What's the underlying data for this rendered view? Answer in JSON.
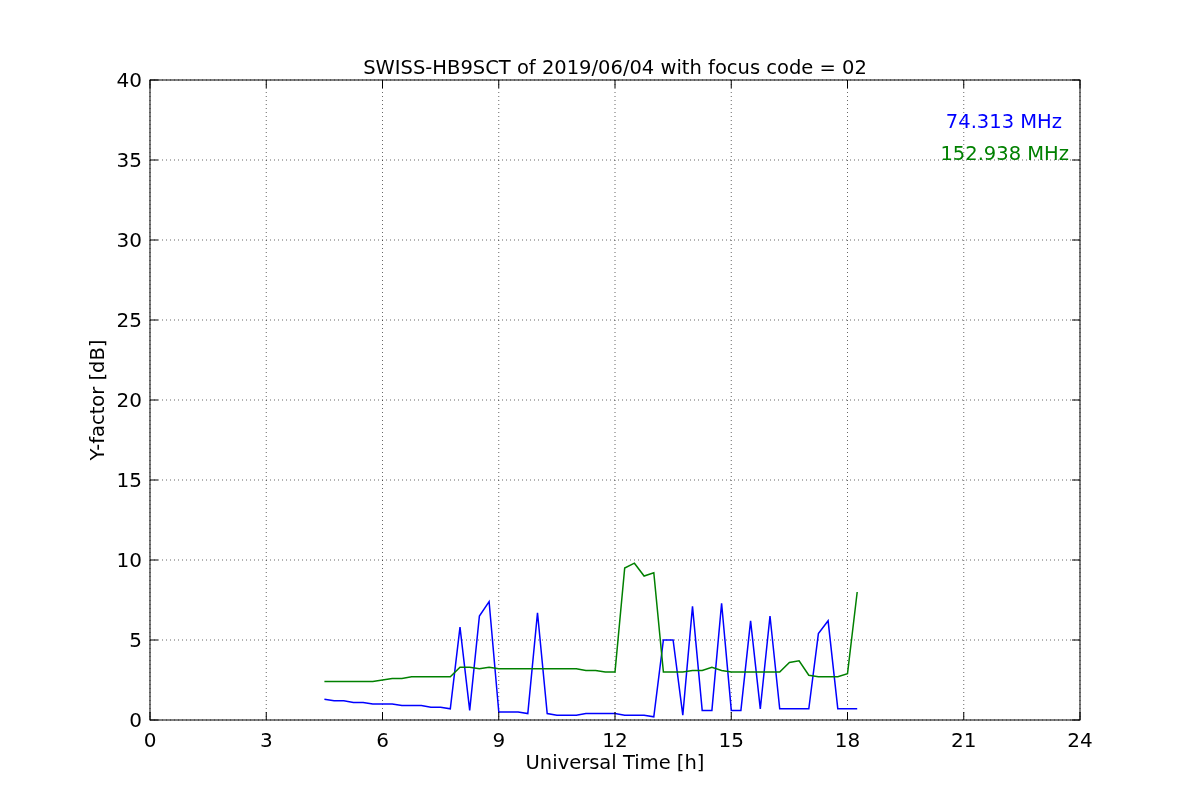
{
  "figure": {
    "chart_data": {
      "type": "line",
      "title": "SWISS-HB9SCT of 2019/06/04 with focus code = 02",
      "xlabel": "Universal Time [h]",
      "ylabel": "Y-factor [dB]",
      "x": [
        4.5,
        4.75,
        5,
        5.25,
        5.5,
        5.75,
        6,
        6.25,
        6.5,
        6.75,
        7,
        7.25,
        7.5,
        7.75,
        8,
        8.25,
        8.5,
        8.75,
        9,
        9.25,
        9.5,
        9.75,
        10,
        10.25,
        10.5,
        10.75,
        11,
        11.25,
        11.5,
        11.75,
        12,
        12.25,
        12.5,
        12.75,
        13,
        13.25,
        13.5,
        13.75,
        14,
        14.25,
        14.5,
        14.75,
        15,
        15.25,
        15.5,
        15.75,
        16,
        16.25,
        16.5,
        16.75,
        17,
        17.25,
        17.5,
        17.75,
        18,
        18.25
      ],
      "series": [
        {
          "name": "74.313 MHz",
          "color": "#0000ff",
          "values": [
            1.3,
            1.2,
            1.2,
            1.1,
            1.1,
            1.0,
            1.0,
            1.0,
            0.9,
            0.9,
            0.9,
            0.8,
            0.8,
            0.7,
            5.8,
            0.6,
            6.5,
            7.4,
            0.5,
            0.5,
            0.5,
            0.4,
            6.7,
            0.4,
            0.3,
            0.3,
            0.3,
            0.4,
            0.4,
            0.4,
            0.4,
            0.3,
            0.3,
            0.3,
            0.2,
            5.0,
            5.0,
            0.3,
            7.1,
            0.6,
            0.6,
            7.3,
            0.6,
            0.6,
            6.2,
            0.7,
            6.5,
            0.7,
            0.7,
            0.7,
            0.7,
            5.4,
            6.2,
            0.7,
            0.7,
            0.7
          ]
        },
        {
          "name": "152.938 MHz",
          "color": "#008000",
          "values": [
            2.4,
            2.4,
            2.4,
            2.4,
            2.4,
            2.4,
            2.5,
            2.6,
            2.6,
            2.7,
            2.7,
            2.7,
            2.7,
            2.7,
            3.3,
            3.3,
            3.2,
            3.3,
            3.2,
            3.2,
            3.2,
            3.2,
            3.2,
            3.2,
            3.2,
            3.2,
            3.2,
            3.1,
            3.1,
            3.0,
            3.0,
            9.5,
            9.8,
            9.0,
            9.2,
            3.0,
            3.0,
            3.0,
            3.1,
            3.1,
            3.3,
            3.1,
            3.0,
            3.0,
            3.0,
            3.0,
            3.0,
            3.0,
            3.6,
            3.7,
            2.8,
            2.7,
            2.7,
            2.7,
            2.9,
            8.0
          ]
        }
      ],
      "xlim": [
        0,
        24
      ],
      "ylim": [
        0,
        40
      ],
      "xticks": [
        0,
        3,
        6,
        9,
        12,
        15,
        18,
        21,
        24
      ],
      "yticks": [
        0,
        5,
        10,
        15,
        20,
        25,
        30,
        35,
        40
      ],
      "grid": true
    }
  }
}
